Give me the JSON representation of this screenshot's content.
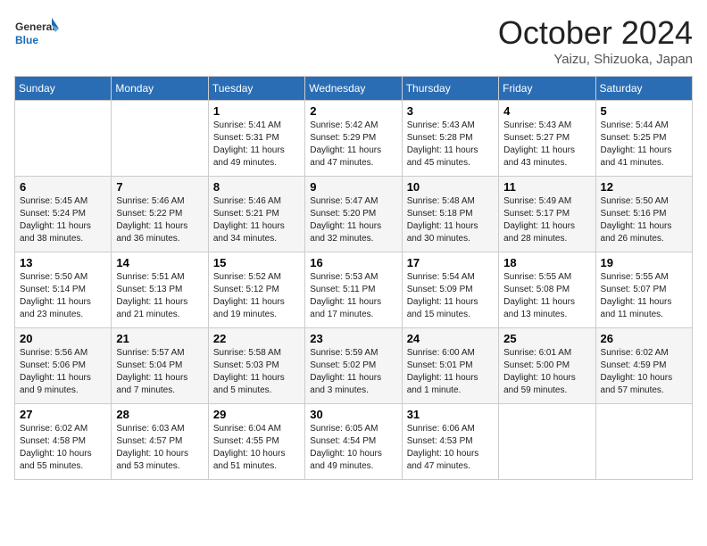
{
  "logo": {
    "general": "General",
    "blue": "Blue"
  },
  "title": "October 2024",
  "location": "Yaizu, Shizuoka, Japan",
  "days_of_week": [
    "Sunday",
    "Monday",
    "Tuesday",
    "Wednesday",
    "Thursday",
    "Friday",
    "Saturday"
  ],
  "weeks": [
    [
      {
        "day": "",
        "empty": true
      },
      {
        "day": "",
        "empty": true
      },
      {
        "day": "1",
        "sunrise": "5:41 AM",
        "sunset": "5:31 PM",
        "daylight": "11 hours and 49 minutes."
      },
      {
        "day": "2",
        "sunrise": "5:42 AM",
        "sunset": "5:29 PM",
        "daylight": "11 hours and 47 minutes."
      },
      {
        "day": "3",
        "sunrise": "5:43 AM",
        "sunset": "5:28 PM",
        "daylight": "11 hours and 45 minutes."
      },
      {
        "day": "4",
        "sunrise": "5:43 AM",
        "sunset": "5:27 PM",
        "daylight": "11 hours and 43 minutes."
      },
      {
        "day": "5",
        "sunrise": "5:44 AM",
        "sunset": "5:25 PM",
        "daylight": "11 hours and 41 minutes."
      }
    ],
    [
      {
        "day": "6",
        "sunrise": "5:45 AM",
        "sunset": "5:24 PM",
        "daylight": "11 hours and 38 minutes."
      },
      {
        "day": "7",
        "sunrise": "5:46 AM",
        "sunset": "5:22 PM",
        "daylight": "11 hours and 36 minutes."
      },
      {
        "day": "8",
        "sunrise": "5:46 AM",
        "sunset": "5:21 PM",
        "daylight": "11 hours and 34 minutes."
      },
      {
        "day": "9",
        "sunrise": "5:47 AM",
        "sunset": "5:20 PM",
        "daylight": "11 hours and 32 minutes."
      },
      {
        "day": "10",
        "sunrise": "5:48 AM",
        "sunset": "5:18 PM",
        "daylight": "11 hours and 30 minutes."
      },
      {
        "day": "11",
        "sunrise": "5:49 AM",
        "sunset": "5:17 PM",
        "daylight": "11 hours and 28 minutes."
      },
      {
        "day": "12",
        "sunrise": "5:50 AM",
        "sunset": "5:16 PM",
        "daylight": "11 hours and 26 minutes."
      }
    ],
    [
      {
        "day": "13",
        "sunrise": "5:50 AM",
        "sunset": "5:14 PM",
        "daylight": "11 hours and 23 minutes."
      },
      {
        "day": "14",
        "sunrise": "5:51 AM",
        "sunset": "5:13 PM",
        "daylight": "11 hours and 21 minutes."
      },
      {
        "day": "15",
        "sunrise": "5:52 AM",
        "sunset": "5:12 PM",
        "daylight": "11 hours and 19 minutes."
      },
      {
        "day": "16",
        "sunrise": "5:53 AM",
        "sunset": "5:11 PM",
        "daylight": "11 hours and 17 minutes."
      },
      {
        "day": "17",
        "sunrise": "5:54 AM",
        "sunset": "5:09 PM",
        "daylight": "11 hours and 15 minutes."
      },
      {
        "day": "18",
        "sunrise": "5:55 AM",
        "sunset": "5:08 PM",
        "daylight": "11 hours and 13 minutes."
      },
      {
        "day": "19",
        "sunrise": "5:55 AM",
        "sunset": "5:07 PM",
        "daylight": "11 hours and 11 minutes."
      }
    ],
    [
      {
        "day": "20",
        "sunrise": "5:56 AM",
        "sunset": "5:06 PM",
        "daylight": "11 hours and 9 minutes."
      },
      {
        "day": "21",
        "sunrise": "5:57 AM",
        "sunset": "5:04 PM",
        "daylight": "11 hours and 7 minutes."
      },
      {
        "day": "22",
        "sunrise": "5:58 AM",
        "sunset": "5:03 PM",
        "daylight": "11 hours and 5 minutes."
      },
      {
        "day": "23",
        "sunrise": "5:59 AM",
        "sunset": "5:02 PM",
        "daylight": "11 hours and 3 minutes."
      },
      {
        "day": "24",
        "sunrise": "6:00 AM",
        "sunset": "5:01 PM",
        "daylight": "11 hours and 1 minute."
      },
      {
        "day": "25",
        "sunrise": "6:01 AM",
        "sunset": "5:00 PM",
        "daylight": "10 hours and 59 minutes."
      },
      {
        "day": "26",
        "sunrise": "6:02 AM",
        "sunset": "4:59 PM",
        "daylight": "10 hours and 57 minutes."
      }
    ],
    [
      {
        "day": "27",
        "sunrise": "6:02 AM",
        "sunset": "4:58 PM",
        "daylight": "10 hours and 55 minutes."
      },
      {
        "day": "28",
        "sunrise": "6:03 AM",
        "sunset": "4:57 PM",
        "daylight": "10 hours and 53 minutes."
      },
      {
        "day": "29",
        "sunrise": "6:04 AM",
        "sunset": "4:55 PM",
        "daylight": "10 hours and 51 minutes."
      },
      {
        "day": "30",
        "sunrise": "6:05 AM",
        "sunset": "4:54 PM",
        "daylight": "10 hours and 49 minutes."
      },
      {
        "day": "31",
        "sunrise": "6:06 AM",
        "sunset": "4:53 PM",
        "daylight": "10 hours and 47 minutes."
      },
      {
        "day": "",
        "empty": true
      },
      {
        "day": "",
        "empty": true
      }
    ]
  ],
  "labels": {
    "sunrise": "Sunrise:",
    "sunset": "Sunset:",
    "daylight": "Daylight:"
  }
}
